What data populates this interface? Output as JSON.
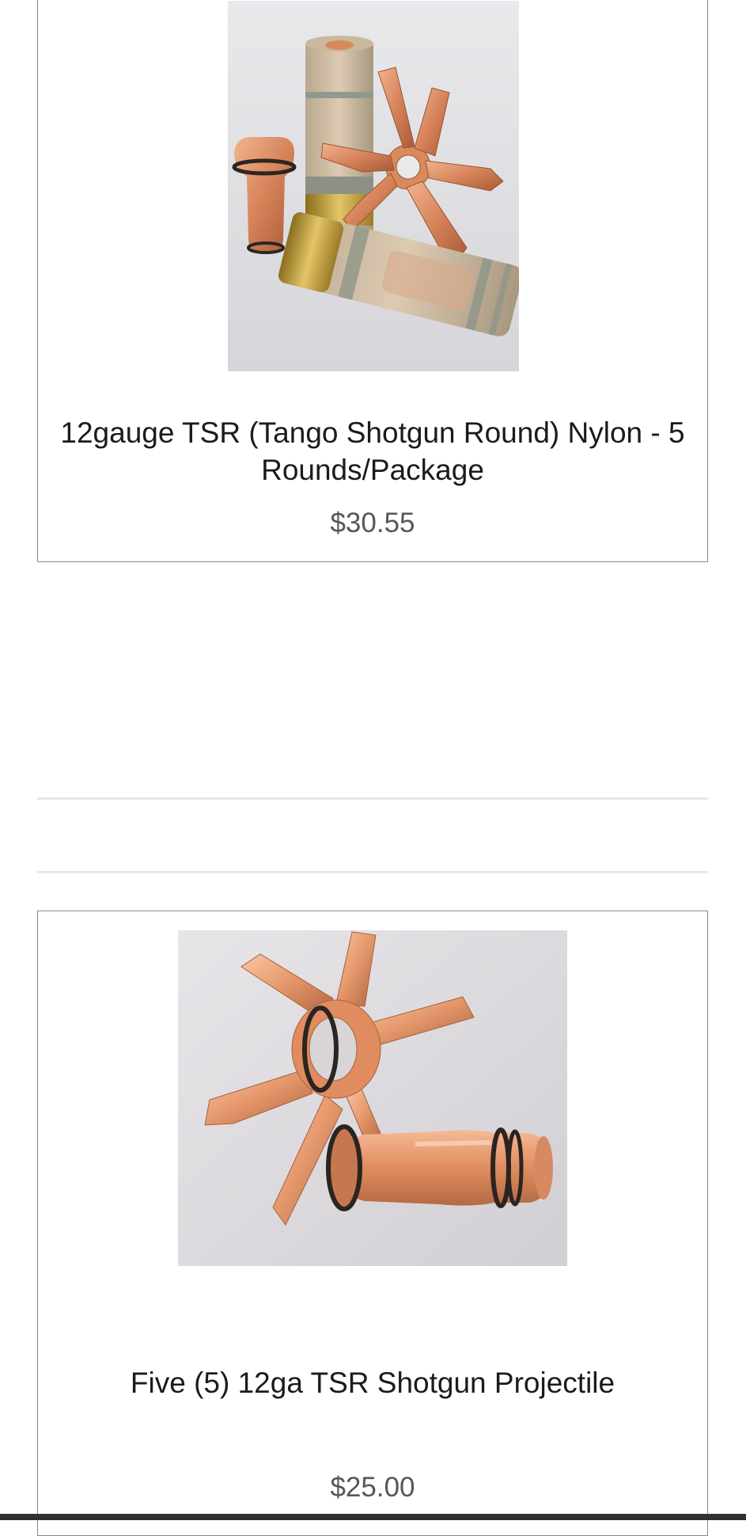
{
  "products": [
    {
      "title": "12gauge TSR (Tango Shotgun Round) Nylon - 5 Rounds/Package",
      "price": "$30.55",
      "image_icon": "shotgun-shells-with-copper-projectile-photo"
    },
    {
      "title": "Five (5) 12ga TSR Shotgun Projectile",
      "price": "$25.00",
      "image_icon": "copper-petal-projectile-photo"
    }
  ],
  "colors": {
    "copper": "#d98a5c",
    "brass": "#c9a441",
    "shell": "#c8b8a0",
    "card_border": "#8a8a8a",
    "price_text": "#575757",
    "divider": "#e8e8e8"
  }
}
